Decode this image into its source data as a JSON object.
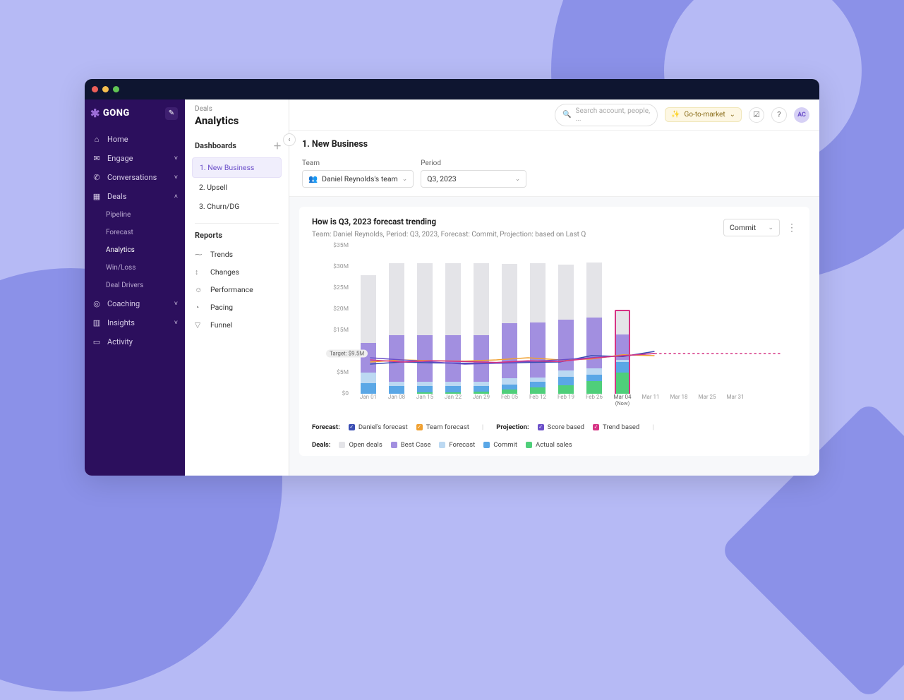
{
  "brand": "GONG",
  "avatar_initials": "AC",
  "topbar": {
    "search_placeholder": "Search account, people, ...",
    "context_label": "Go-to-market"
  },
  "breadcrumb": "Deals",
  "page_title": "Analytics",
  "sidebar": {
    "items": [
      {
        "label": "Home",
        "icon": "⌂"
      },
      {
        "label": "Engage",
        "icon": "✉",
        "expandable": true
      },
      {
        "label": "Conversations",
        "icon": "✆",
        "expandable": true
      },
      {
        "label": "Deals",
        "icon": "▦",
        "expandable": true,
        "expanded": true,
        "children": [
          {
            "label": "Pipeline"
          },
          {
            "label": "Forecast"
          },
          {
            "label": "Analytics",
            "active": true
          },
          {
            "label": "Win/Loss"
          },
          {
            "label": "Deal Drivers"
          }
        ]
      },
      {
        "label": "Coaching",
        "icon": "◎",
        "expandable": true
      },
      {
        "label": "Insights",
        "icon": "▥",
        "expandable": true
      },
      {
        "label": "Activity",
        "icon": "▭"
      }
    ]
  },
  "mid": {
    "dashboards_header": "Dashboards",
    "dashboards": [
      {
        "label": "1. New Business",
        "active": true
      },
      {
        "label": "2. Upsell"
      },
      {
        "label": "3. Churn/DG"
      }
    ],
    "reports_header": "Reports",
    "reports": [
      {
        "label": "Trends",
        "icon": "⁓"
      },
      {
        "label": "Changes",
        "icon": "↕"
      },
      {
        "label": "Performance",
        "icon": "☺"
      },
      {
        "label": "Pacing",
        "icon": "◔"
      },
      {
        "label": "Funnel",
        "icon": "▽"
      }
    ]
  },
  "filters": {
    "section_title": "1. New Business",
    "team_label": "Team",
    "team_value": "Daniel Reynolds's team",
    "period_label": "Period",
    "period_value": "Q3, 2023"
  },
  "card": {
    "title": "How is Q3, 2023 forecast trending",
    "subtitle": "Team: Daniel Reynolds, Period: Q3, 2023, Forecast: Commit, Projection: based on Last Q",
    "dropdown": "Commit"
  },
  "legend": {
    "forecast_head": "Forecast:",
    "forecast": [
      {
        "label": "Daniel's forecast",
        "color": "#3a4db3"
      },
      {
        "label": "Team forecast",
        "color": "#f0a030"
      }
    ],
    "projection_head": "Projection:",
    "projection": [
      {
        "label": "Score based",
        "color": "#6b4fc9"
      },
      {
        "label": "Trend based",
        "color": "#d63384"
      }
    ],
    "deals_head": "Deals:",
    "deals": [
      {
        "label": "Open deals",
        "color": "#e4e4e8"
      },
      {
        "label": "Best Case",
        "color": "#a28fe0"
      },
      {
        "label": "Forecast",
        "color": "#bcd9f2"
      },
      {
        "label": "Commit",
        "color": "#5aa7e6"
      },
      {
        "label": "Actual sales",
        "color": "#4fcf7a"
      }
    ]
  },
  "chart_data": {
    "type": "bar",
    "ylabel": "",
    "ylim": [
      0,
      35
    ],
    "y_ticks": [
      "$0",
      "$5M",
      "$9.5M",
      "$15M",
      "$20M",
      "$25M",
      "$30M",
      "$35M"
    ],
    "y_tick_values": [
      0,
      5,
      9.5,
      15,
      20,
      25,
      30,
      35
    ],
    "target_label": "Target:  $9.5M",
    "target_value": 9.5,
    "categories": [
      "Jan 01",
      "Jan 08",
      "Jan 15",
      "Jan 22",
      "Jan 29",
      "Feb 05",
      "Feb 12",
      "Feb 19",
      "Feb 26",
      "Mar 04",
      "Mar 11",
      "Mar 18",
      "Mar 25",
      "Mar 31"
    ],
    "now_index": 9,
    "now_sublabel": "(Now)",
    "stacks": {
      "series_order": [
        "actual",
        "commit",
        "forecast",
        "best",
        "open"
      ],
      "values": [
        [
          0.0,
          2.5,
          2.5,
          7.0,
          16.0
        ],
        [
          0.0,
          1.8,
          1.0,
          11.0,
          17.0
        ],
        [
          0.3,
          1.5,
          1.0,
          11.0,
          17.0
        ],
        [
          0.4,
          1.4,
          1.0,
          11.0,
          17.0
        ],
        [
          0.5,
          1.3,
          1.0,
          11.0,
          17.0
        ],
        [
          1.0,
          1.2,
          1.5,
          13.0,
          14.0
        ],
        [
          1.5,
          1.3,
          1.0,
          13.0,
          14.0
        ],
        [
          2.0,
          2.0,
          1.5,
          12.0,
          13.0
        ],
        [
          3.0,
          1.5,
          1.5,
          12.0,
          13.0
        ],
        [
          5.0,
          2.5,
          0.5,
          6.0,
          5.5
        ]
      ]
    },
    "lines": {
      "daniel": [
        7.0,
        7.5,
        7.3,
        7.2,
        7.2,
        7.4,
        7.5,
        9.0,
        8.8,
        10.0
      ],
      "team": [
        7.5,
        8.0,
        7.8,
        7.7,
        8.0,
        8.5,
        8.0,
        8.2,
        9.2,
        9.0
      ],
      "score": [
        8.5,
        8.0,
        7.5,
        7.0,
        7.2,
        7.6,
        8.0,
        8.5,
        9.0,
        9.5
      ],
      "trend": [
        8.0,
        7.5,
        7.8,
        7.6,
        7.4,
        7.8,
        7.6,
        8.4,
        9.0,
        9.5
      ],
      "trend_extension_to": 13,
      "trend_extension_value": 9.5
    }
  }
}
